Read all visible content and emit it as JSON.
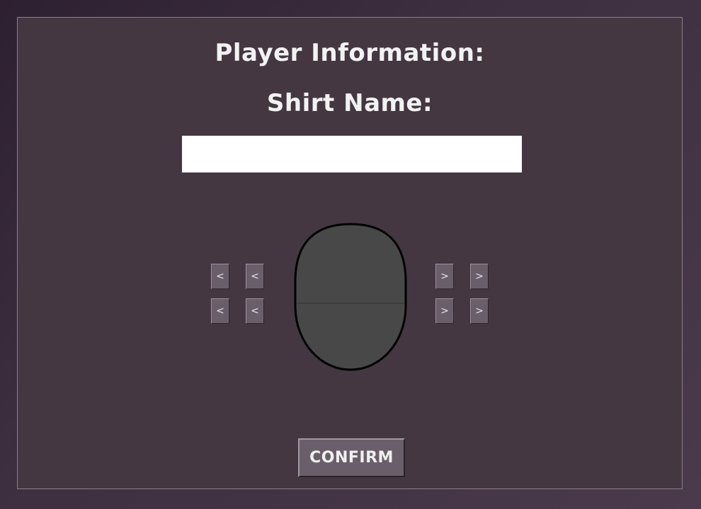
{
  "panel": {
    "title": "Player Information:",
    "subtitle": "Shirt Name:"
  },
  "shirt_name": {
    "value": "",
    "placeholder": ""
  },
  "customizer": {
    "left_arrow": "<",
    "right_arrow": ">",
    "head_fill": "#484848",
    "head_outline": "#000000"
  },
  "confirm": {
    "label": "CONFIRM"
  }
}
